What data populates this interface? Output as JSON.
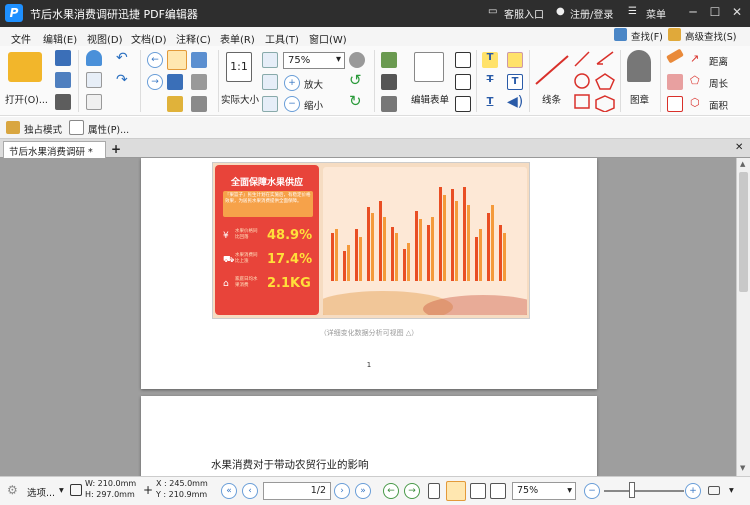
{
  "window": {
    "title": "节后水果消费调研迅捷 PDF编辑器",
    "logo": "P",
    "service": "客服入口",
    "login": "注册/登录",
    "menu": "菜单"
  },
  "menubar": {
    "items": [
      "文件",
      "编辑(E)",
      "视图(D)",
      "文档(D)",
      "注释(C)",
      "表单(R)",
      "工具(T)",
      "窗口(W)"
    ],
    "find": "查找(F)",
    "advanced_find": "高级查找(S)"
  },
  "ribbon": {
    "open": "打开(O)...",
    "actual_size": "实际大小",
    "zoom": "75%",
    "zoom_in": "放大",
    "zoom_out": "缩小",
    "edit_form": "编辑表单",
    "line": "线条",
    "stamp": "图章",
    "distance": "距离",
    "perimeter": "周长",
    "area": "面积"
  },
  "bar2": {
    "exclusive": "独占模式",
    "properties": "属性(P)..."
  },
  "tab": {
    "label": "节后水果消费调研 *"
  },
  "doc": {
    "banner_title": "全面保障水果供应",
    "banner_note": "『果篮子』民生计划在实施后，有稳定价格效果，为居民水果消费提供全面保障。",
    "stats": [
      {
        "label": "水果价格同比回落",
        "value": "48.9%"
      },
      {
        "label": "水果消费同比上涨",
        "value": "17.4%"
      },
      {
        "label": "家庭日均水果消费",
        "value": "2.1KG"
      }
    ],
    "caption": "（详细变化数据分析可视图 △）",
    "page_number": "1",
    "page2_heading": "水果消费对于带动农贸行业的影响"
  },
  "status": {
    "select": "选项...",
    "w": "W: 210.0mm",
    "h": "H: 297.0mm",
    "x": "X : 245.0mm",
    "y": "Y : 210.9mm",
    "page": "1/2",
    "zoom": "75%"
  }
}
